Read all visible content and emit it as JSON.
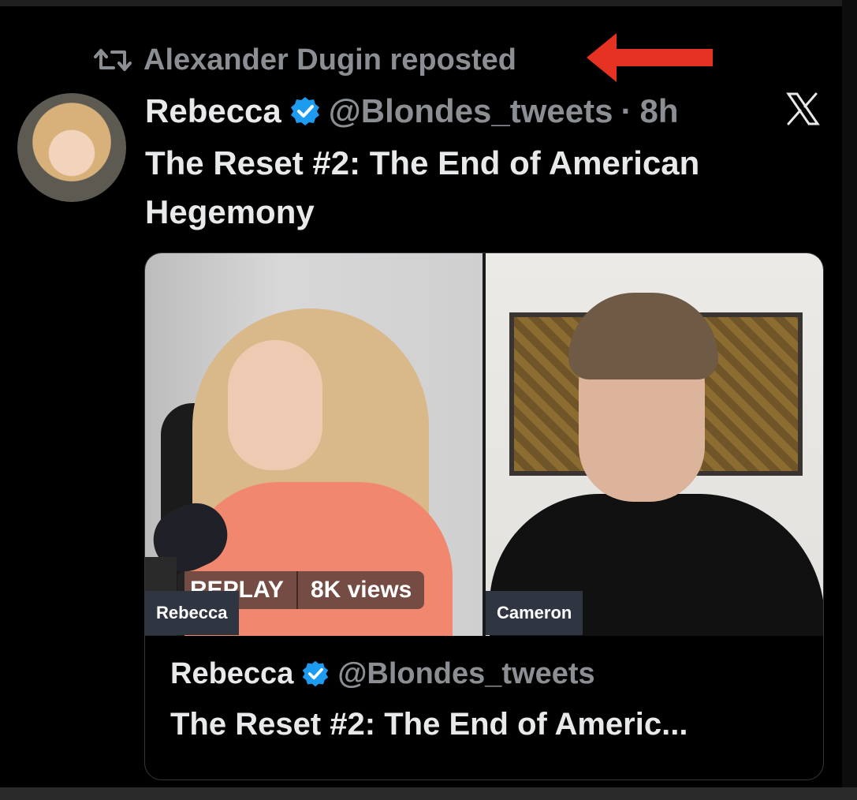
{
  "repost": {
    "text": "Alexander Dugin reposted"
  },
  "tweet": {
    "name": "Rebecca",
    "handle": "@Blondes_tweets",
    "separator": "·",
    "time": "8h",
    "text_line1": "The Reset #2: The End of American",
    "text_line2": "Hegemony"
  },
  "media": {
    "replay_label": "REPLAY",
    "views": "8K views",
    "left_tag": "Rebecca",
    "right_tag": "Cameron"
  },
  "card": {
    "name": "Rebecca",
    "handle": "@Blondes_tweets",
    "title": "The Reset #2: The End of Americ..."
  },
  "colors": {
    "background": "#000000",
    "verified": "#1d9bf0",
    "annotation_arrow": "#e53223",
    "muted_text": "#8b8f94"
  },
  "icons": [
    "repost-icon",
    "verified-icon",
    "x-logo-icon",
    "red-arrow-annotation"
  ]
}
